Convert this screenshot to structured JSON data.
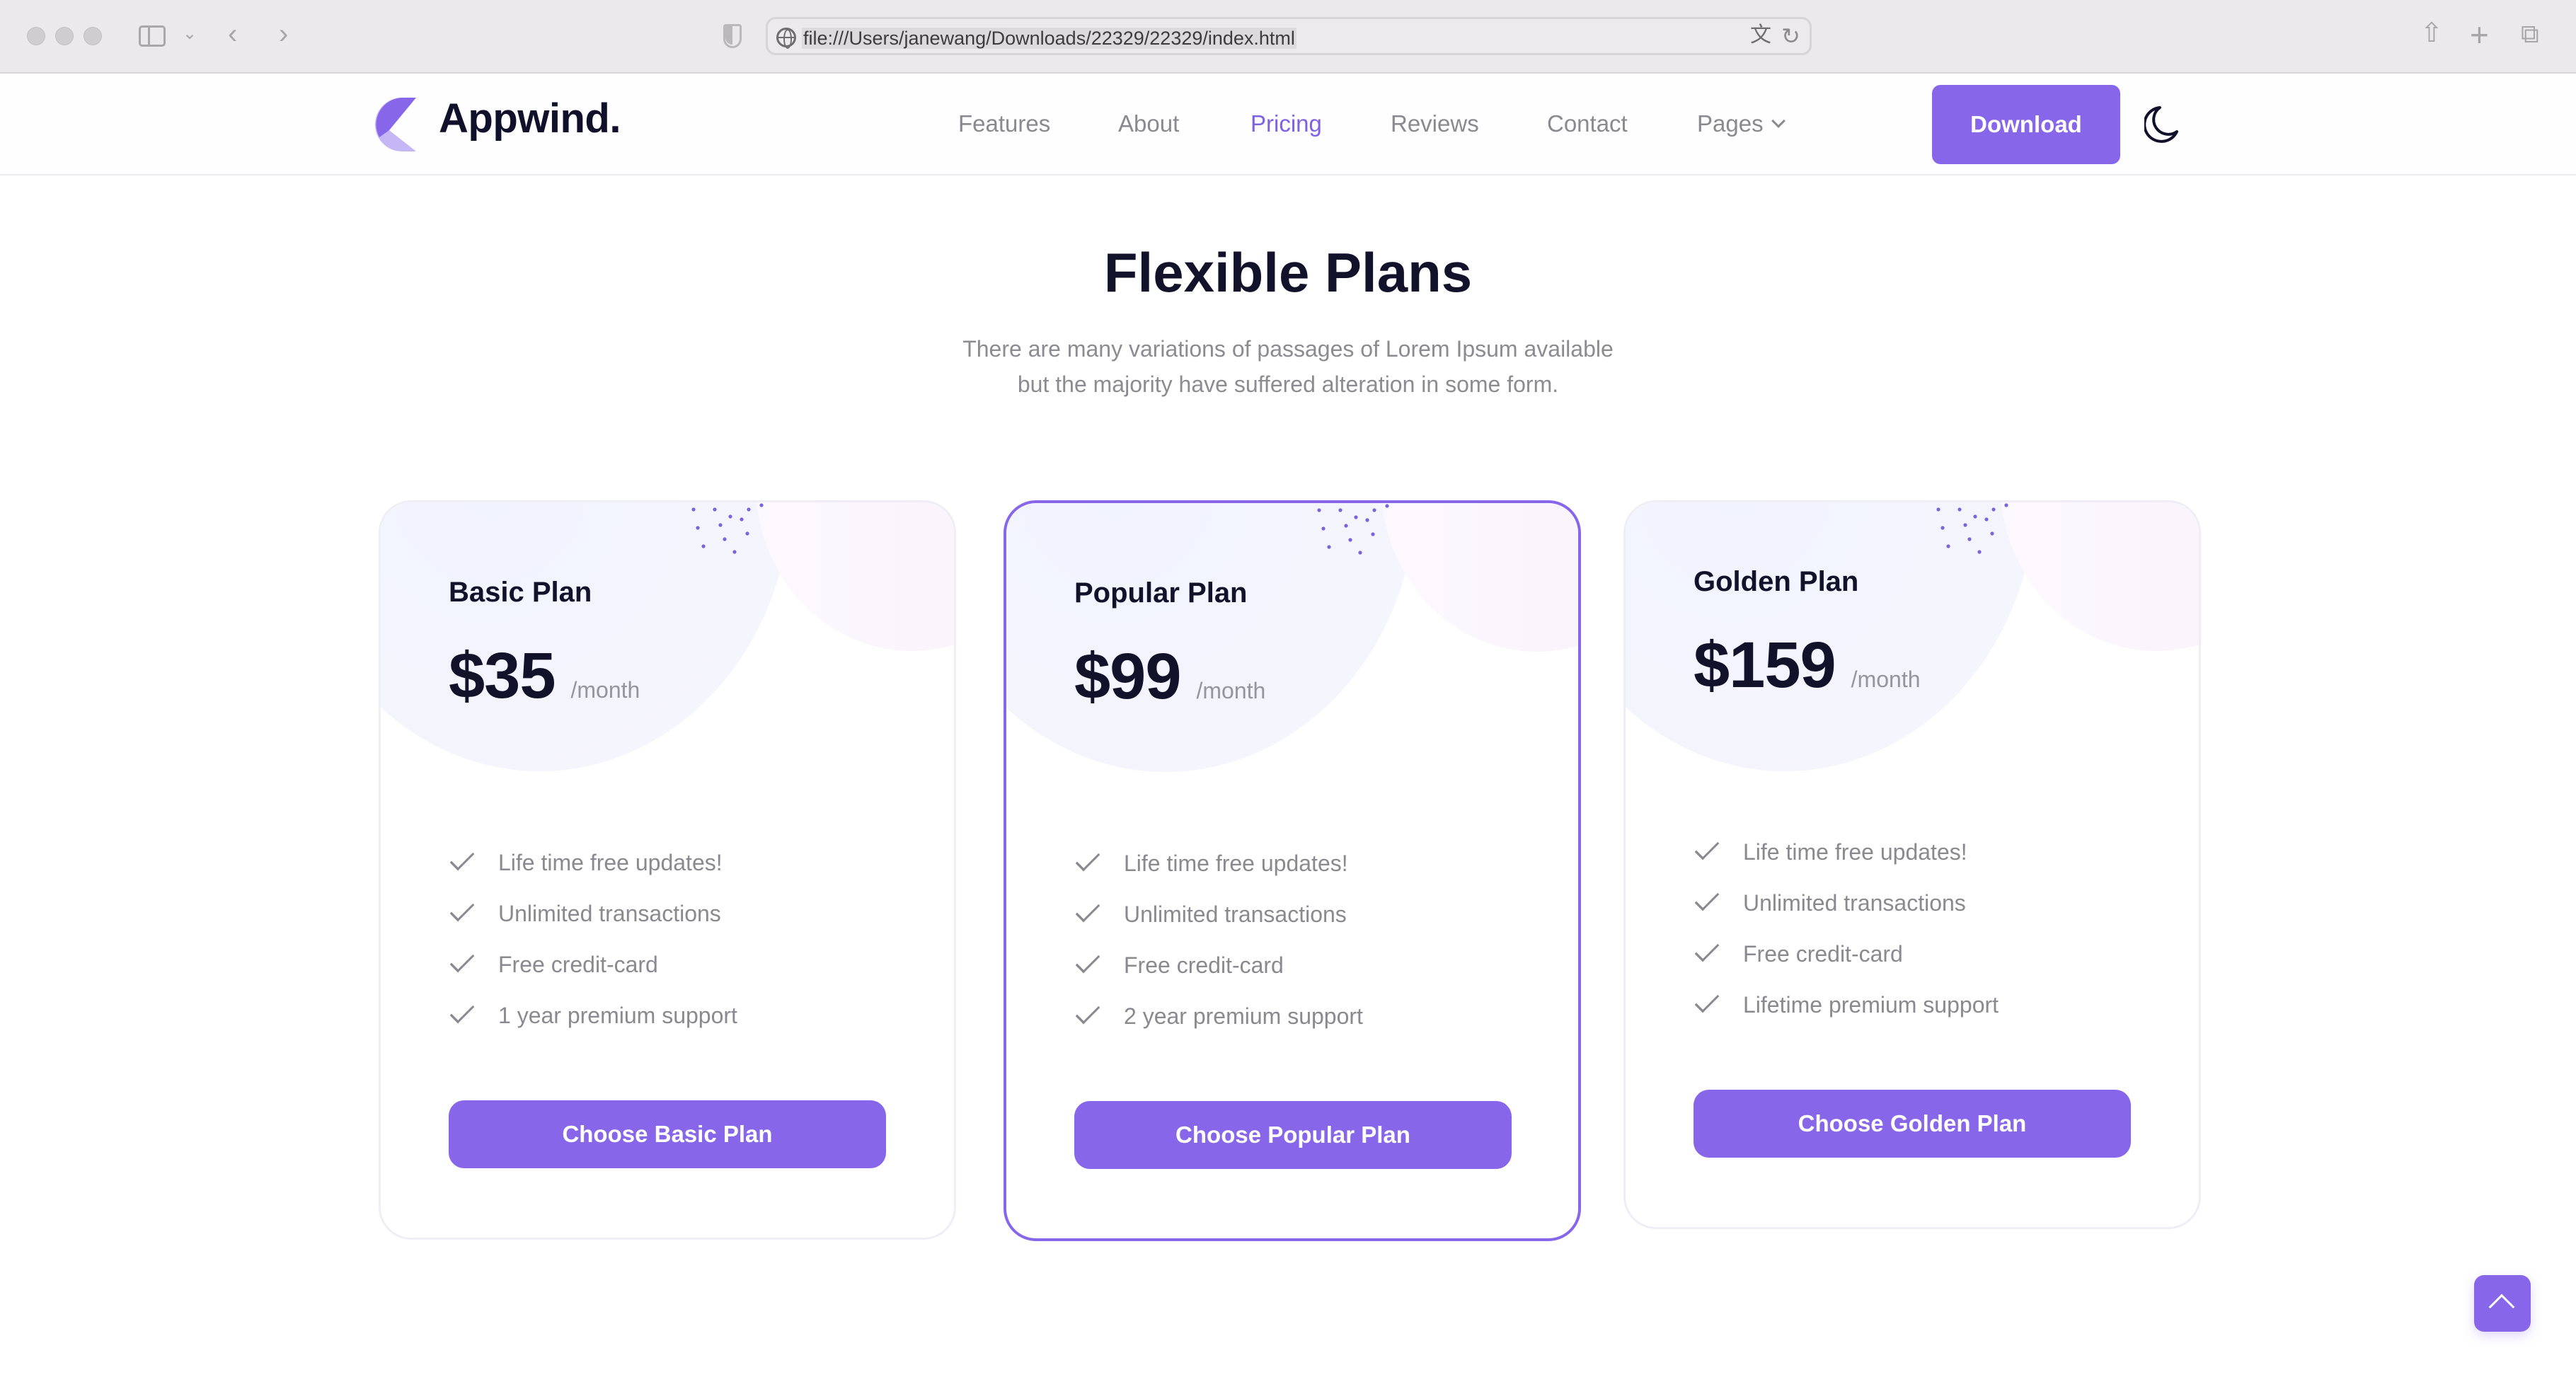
{
  "browser": {
    "url": "file:///Users/janewang/Downloads/22329/22329/index.html"
  },
  "header": {
    "brand": "Appwind.",
    "nav": [
      {
        "label": "Features",
        "active": false
      },
      {
        "label": "About",
        "active": false
      },
      {
        "label": "Pricing",
        "active": true
      },
      {
        "label": "Reviews",
        "active": false
      },
      {
        "label": "Contact",
        "active": false
      },
      {
        "label": "Pages",
        "active": false,
        "has_dropdown": true
      }
    ],
    "download_label": "Download",
    "theme_toggle_icon": "moon-icon"
  },
  "pricing": {
    "title": "Flexible Plans",
    "subtitle_line1": "There are many variations of passages of Lorem Ipsum available",
    "subtitle_line2": "but the majority have suffered alteration in some form.",
    "plans": [
      {
        "name": "Basic Plan",
        "price": "$35",
        "period": "/month",
        "featured": false,
        "features": [
          "Life time free updates!",
          "Unlimited transactions",
          "Free credit-card",
          "1 year premium support"
        ],
        "cta": "Choose Basic Plan"
      },
      {
        "name": "Popular Plan",
        "price": "$99",
        "period": "/month",
        "featured": true,
        "features": [
          "Life time free updates!",
          "Unlimited transactions",
          "Free credit-card",
          "2 year premium support"
        ],
        "cta": "Choose Popular Plan"
      },
      {
        "name": "Golden Plan",
        "price": "$159",
        "period": "/month",
        "featured": false,
        "features": [
          "Life time free updates!",
          "Unlimited transactions",
          "Free credit-card",
          "Lifetime premium support"
        ],
        "cta": "Choose Golden Plan"
      }
    ]
  },
  "colors": {
    "accent": "#8766ea",
    "heading": "#12122a",
    "muted": "#8a898f"
  }
}
